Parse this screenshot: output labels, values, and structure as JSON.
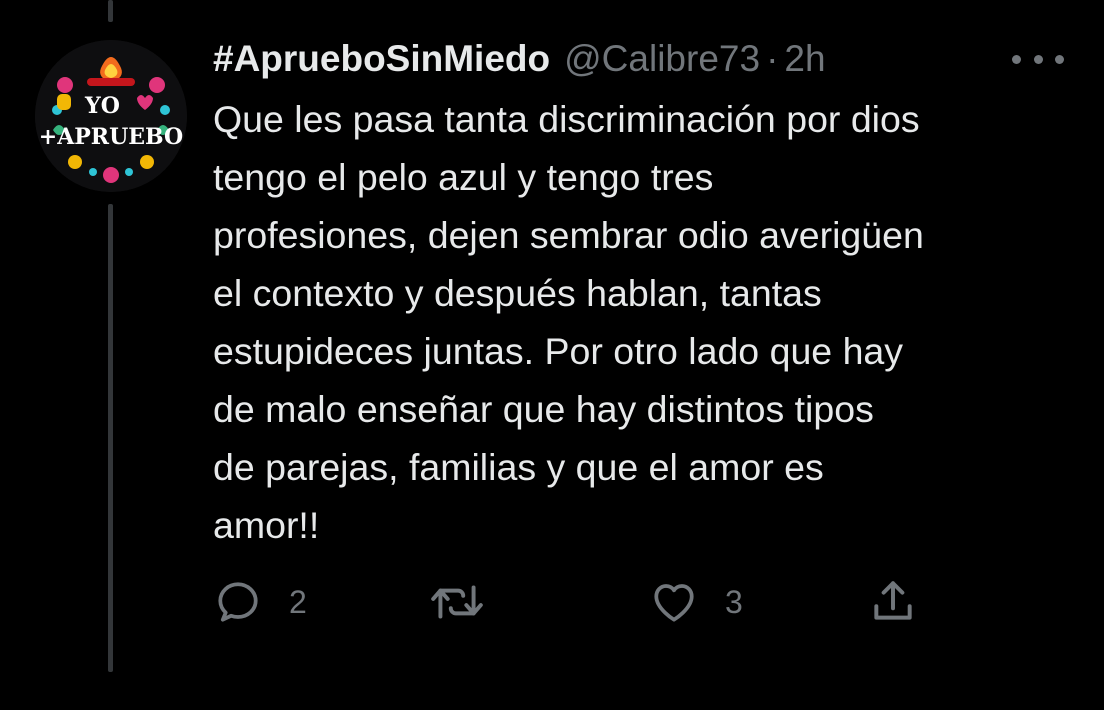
{
  "tweet": {
    "display_name": "#AprueboSinMiedo",
    "handle": "@Calibre73",
    "separator": "·",
    "time": "2h",
    "text": "Que les pasa tanta discriminación por dios\ntengo el pelo azul y tengo tres\nprofesiones, dejen sembrar odio averigüen\nel contexto y después hablan, tantas\nestupideces juntas. Por otro lado que hay\nde malo enseñar que hay distintos tipos\nde parejas, familias y que el amor es\namor!!",
    "avatar_text": {
      "line1": "YO",
      "line2": "+APRUEBO"
    }
  },
  "actions": {
    "reply": {
      "icon": "reply-icon",
      "count": "2"
    },
    "retweet": {
      "icon": "retweet-icon"
    },
    "like": {
      "icon": "heart-icon",
      "count": "3"
    },
    "share": {
      "icon": "share-icon"
    }
  },
  "colors": {
    "background": "#000000",
    "primary_text": "#e7e9ea",
    "secondary_text": "#71767b",
    "thread_line": "#333639"
  }
}
